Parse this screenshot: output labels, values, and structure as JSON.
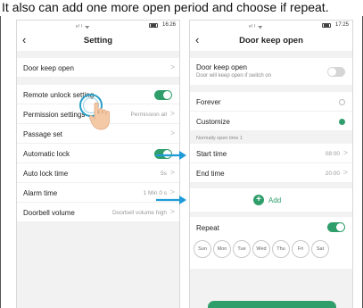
{
  "caption": "It also can add one more open period and choose if repeat.",
  "colors": {
    "accent": "#2f9e6b",
    "arrow": "#1e9ad6",
    "touch": "#2aa0c8"
  },
  "left_phone": {
    "status": {
      "signal": "ᵒˡ ˡ ᯤ",
      "time": "16:26"
    },
    "title": "Setting",
    "back_icon": "chevron-left-icon",
    "rows": [
      {
        "label": "Door keep open",
        "value": "",
        "chevron": ">"
      },
      {
        "label": "Remote unlock setting",
        "toggle": true
      },
      {
        "label": "Permission settings",
        "value": "Permission all",
        "chevron": ">"
      },
      {
        "label": "Passage set",
        "value": "",
        "chevron": ">"
      },
      {
        "label": "Automatic lock",
        "toggle": true
      },
      {
        "label": "Auto lock time",
        "value": "5s",
        "chevron": ">"
      },
      {
        "label": "Alarm time",
        "value": "1 Min 0 s",
        "chevron": ">"
      },
      {
        "label": "Doorbell volume",
        "value": "Doorbell volume high",
        "chevron": ">"
      }
    ]
  },
  "right_phone": {
    "status": {
      "signal": "ᵒˡ ˡ ᯤ",
      "time": "17:25"
    },
    "title": "Door keep open",
    "back_icon": "chevron-left-icon",
    "keep_open": {
      "label": "Door keep open",
      "desc": "Door will keep open if switch on",
      "toggle": false
    },
    "modes": [
      {
        "label": "Forever",
        "selected": false
      },
      {
        "label": "Customize",
        "selected": true
      }
    ],
    "section_label": "Normally open time 1",
    "times": [
      {
        "label": "Start time",
        "value": "08:00",
        "chevron": ">"
      },
      {
        "label": "End time",
        "value": "20:00",
        "chevron": ">"
      }
    ],
    "add_label": "Add",
    "repeat": {
      "label": "Repeat",
      "toggle": true,
      "days": [
        "Sun",
        "Mon",
        "Tue",
        "Wed",
        "Thu",
        "Fri",
        "Sat"
      ]
    }
  }
}
